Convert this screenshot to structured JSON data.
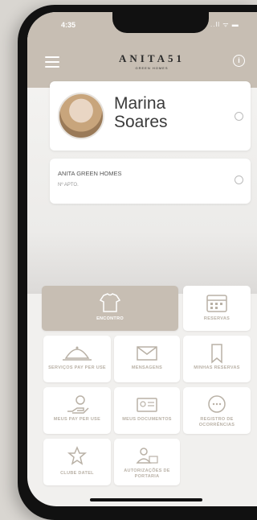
{
  "status": {
    "time": "4:35",
    "icons": "..ll ᯤ ▬"
  },
  "header": {
    "logo_main": "ANITA51",
    "logo_sub": "GREEN HOMES"
  },
  "profile": {
    "first_name": "Marina",
    "last_name": "Soares"
  },
  "unit": {
    "title": "ANITA GREEN HOMES",
    "subtitle": "Nº APTO."
  },
  "grid": {
    "tiles": [
      {
        "label": "ENCONTRO",
        "icon": "shirt-icon"
      },
      {
        "label": "RESERVAS",
        "icon": "calendar-icon"
      },
      {
        "label": "SERVIÇOS PAY PER USE",
        "icon": "cloche-icon"
      },
      {
        "label": "MENSAGENS",
        "icon": "envelope-icon"
      },
      {
        "label": "MINHAS RESERVAS",
        "icon": "bookmark-icon"
      },
      {
        "label": "MEUS PAY PER USE",
        "icon": "hand-coin-icon"
      },
      {
        "label": "MEUS DOCUMENTOS",
        "icon": "document-icon"
      },
      {
        "label": "REGISTRO DE OCORRÊNCIAS",
        "icon": "chat-icon"
      },
      {
        "label": "CLUBE DATEL",
        "icon": "star-icon"
      },
      {
        "label": "AUTORIZAÇÕES DE PORTARIA",
        "icon": "people-icon"
      }
    ]
  },
  "colors": {
    "accent": "#c7beb3",
    "label": "#b9b1a6"
  }
}
